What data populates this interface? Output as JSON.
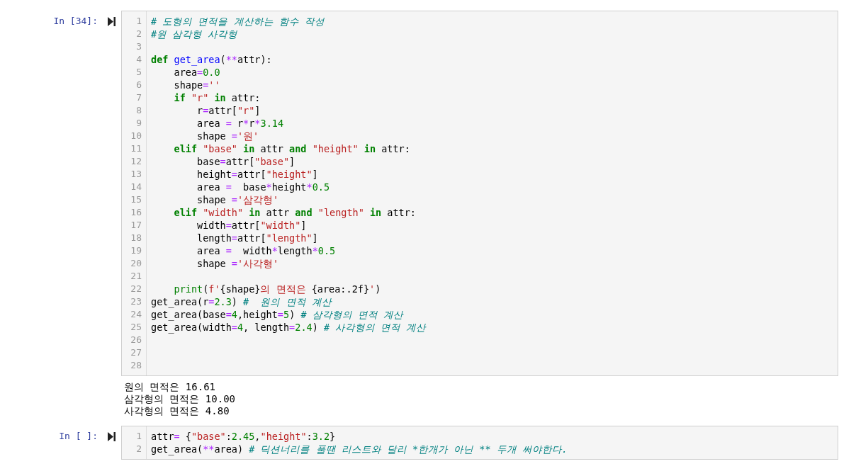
{
  "cells": [
    {
      "prompt": "In [34]:",
      "lines": [
        {
          "number": "1",
          "tokens": [
            {
              "text": "# 도형의 면적을 계산하는 함수 작성",
              "kind": "comment"
            }
          ]
        },
        {
          "number": "2",
          "tokens": [
            {
              "text": "#원 삼각형 사각형",
              "kind": "comment"
            }
          ]
        },
        {
          "number": "3"
        },
        {
          "number": "4",
          "tokens": [
            {
              "text": "def",
              "kind": "keyword"
            },
            {
              "text": " get_area",
              "kind": "function"
            },
            {
              "text": "(",
              "kind": "plain"
            },
            {
              "text": "**",
              "kind": "operator"
            },
            {
              "text": "attr):",
              "kind": "plain"
            }
          ]
        },
        {
          "number": "5",
          "tokens": [
            {
              "text": "    area",
              "kind": "plain"
            },
            {
              "text": "=",
              "kind": "operator"
            },
            {
              "text": "0.0",
              "kind": "number"
            }
          ]
        },
        {
          "number": "6",
          "tokens": [
            {
              "text": "    shape",
              "kind": "plain"
            },
            {
              "text": "=",
              "kind": "operator"
            },
            {
              "text": "''",
              "kind": "string"
            }
          ]
        },
        {
          "number": "7",
          "tokens": [
            {
              "text": "    if",
              "kind": "keyword"
            },
            {
              "text": " \"r\"",
              "kind": "string"
            },
            {
              "text": " in",
              "kind": "keyword"
            },
            {
              "text": " attr:",
              "kind": "plain"
            }
          ]
        },
        {
          "number": "8",
          "tokens": [
            {
              "text": "        r",
              "kind": "plain"
            },
            {
              "text": "=",
              "kind": "operator"
            },
            {
              "text": "attr[",
              "kind": "plain"
            },
            {
              "text": "\"r\"",
              "kind": "string"
            },
            {
              "text": "]",
              "kind": "plain"
            }
          ]
        },
        {
          "number": "9",
          "tokens": [
            {
              "text": "        area ",
              "kind": "plain"
            },
            {
              "text": "=",
              "kind": "operator"
            },
            {
              "text": " r",
              "kind": "plain"
            },
            {
              "text": "*",
              "kind": "operator"
            },
            {
              "text": "r",
              "kind": "plain"
            },
            {
              "text": "*",
              "kind": "operator"
            },
            {
              "text": "3.14",
              "kind": "number"
            }
          ]
        },
        {
          "number": "10",
          "tokens": [
            {
              "text": "        shape ",
              "kind": "plain"
            },
            {
              "text": "=",
              "kind": "operator"
            },
            {
              "text": "'원'",
              "kind": "string"
            }
          ]
        },
        {
          "number": "11",
          "tokens": [
            {
              "text": "    elif",
              "kind": "keyword"
            },
            {
              "text": " \"base\"",
              "kind": "string"
            },
            {
              "text": " in",
              "kind": "keyword"
            },
            {
              "text": " attr ",
              "kind": "plain"
            },
            {
              "text": "and",
              "kind": "keyword"
            },
            {
              "text": " \"height\"",
              "kind": "string"
            },
            {
              "text": " in",
              "kind": "keyword"
            },
            {
              "text": " attr:",
              "kind": "plain"
            }
          ]
        },
        {
          "number": "12",
          "tokens": [
            {
              "text": "        base",
              "kind": "plain"
            },
            {
              "text": "=",
              "kind": "operator"
            },
            {
              "text": "attr[",
              "kind": "plain"
            },
            {
              "text": "\"base\"",
              "kind": "string"
            },
            {
              "text": "]",
              "kind": "plain"
            }
          ]
        },
        {
          "number": "13",
          "tokens": [
            {
              "text": "        height",
              "kind": "plain"
            },
            {
              "text": "=",
              "kind": "operator"
            },
            {
              "text": "attr[",
              "kind": "plain"
            },
            {
              "text": "\"height\"",
              "kind": "string"
            },
            {
              "text": "]",
              "kind": "plain"
            }
          ]
        },
        {
          "number": "14",
          "tokens": [
            {
              "text": "        area ",
              "kind": "plain"
            },
            {
              "text": "=",
              "kind": "operator"
            },
            {
              "text": "  base",
              "kind": "plain"
            },
            {
              "text": "*",
              "kind": "operator"
            },
            {
              "text": "height",
              "kind": "plain"
            },
            {
              "text": "*",
              "kind": "operator"
            },
            {
              "text": "0.5",
              "kind": "number"
            }
          ]
        },
        {
          "number": "15",
          "tokens": [
            {
              "text": "        shape ",
              "kind": "plain"
            },
            {
              "text": "=",
              "kind": "operator"
            },
            {
              "text": "'삼각형'",
              "kind": "string"
            }
          ]
        },
        {
          "number": "16",
          "tokens": [
            {
              "text": "    elif",
              "kind": "keyword"
            },
            {
              "text": " \"width\"",
              "kind": "string"
            },
            {
              "text": " in",
              "kind": "keyword"
            },
            {
              "text": " attr ",
              "kind": "plain"
            },
            {
              "text": "and",
              "kind": "keyword"
            },
            {
              "text": " \"length\"",
              "kind": "string"
            },
            {
              "text": " in",
              "kind": "keyword"
            },
            {
              "text": " attr:",
              "kind": "plain"
            }
          ]
        },
        {
          "number": "17",
          "tokens": [
            {
              "text": "        width",
              "kind": "plain"
            },
            {
              "text": "=",
              "kind": "operator"
            },
            {
              "text": "attr[",
              "kind": "plain"
            },
            {
              "text": "\"width\"",
              "kind": "string"
            },
            {
              "text": "]",
              "kind": "plain"
            }
          ]
        },
        {
          "number": "18",
          "tokens": [
            {
              "text": "        length",
              "kind": "plain"
            },
            {
              "text": "=",
              "kind": "operator"
            },
            {
              "text": "attr[",
              "kind": "plain"
            },
            {
              "text": "\"length\"",
              "kind": "string"
            },
            {
              "text": "]",
              "kind": "plain"
            }
          ]
        },
        {
          "number": "19",
          "tokens": [
            {
              "text": "        area ",
              "kind": "plain"
            },
            {
              "text": "=",
              "kind": "operator"
            },
            {
              "text": "  width",
              "kind": "plain"
            },
            {
              "text": "*",
              "kind": "operator"
            },
            {
              "text": "length",
              "kind": "plain"
            },
            {
              "text": "*",
              "kind": "operator"
            },
            {
              "text": "0.5",
              "kind": "number"
            }
          ]
        },
        {
          "number": "20",
          "tokens": [
            {
              "text": "        shape ",
              "kind": "plain"
            },
            {
              "text": "=",
              "kind": "operator"
            },
            {
              "text": "'사각형'",
              "kind": "string"
            }
          ]
        },
        {
          "number": "21"
        },
        {
          "number": "22",
          "tokens": [
            {
              "text": "    print",
              "kind": "builtin"
            },
            {
              "text": "(",
              "kind": "plain"
            },
            {
              "text": "f'",
              "kind": "string"
            },
            {
              "text": "{shape}",
              "kind": "plain"
            },
            {
              "text": "의 면적은 ",
              "kind": "string"
            },
            {
              "text": "{area:.2f}",
              "kind": "plain"
            },
            {
              "text": "'",
              "kind": "string"
            },
            {
              "text": ")",
              "kind": "plain"
            }
          ]
        },
        {
          "number": "23",
          "tokens": [
            {
              "text": "get_area(r",
              "kind": "plain"
            },
            {
              "text": "=",
              "kind": "operator"
            },
            {
              "text": "2.3",
              "kind": "number"
            },
            {
              "text": ") ",
              "kind": "plain"
            },
            {
              "text": "#  원의 면적 계산",
              "kind": "comment"
            }
          ]
        },
        {
          "number": "24",
          "tokens": [
            {
              "text": "get_area(base",
              "kind": "plain"
            },
            {
              "text": "=",
              "kind": "operator"
            },
            {
              "text": "4",
              "kind": "number"
            },
            {
              "text": ",height",
              "kind": "plain"
            },
            {
              "text": "=",
              "kind": "operator"
            },
            {
              "text": "5",
              "kind": "number"
            },
            {
              "text": ") ",
              "kind": "plain"
            },
            {
              "text": "# 삼각형의 면적 계산",
              "kind": "comment"
            }
          ]
        },
        {
          "number": "25",
          "tokens": [
            {
              "text": "get_area(width",
              "kind": "plain"
            },
            {
              "text": "=",
              "kind": "operator"
            },
            {
              "text": "4",
              "kind": "number"
            },
            {
              "text": ", length",
              "kind": "plain"
            },
            {
              "text": "=",
              "kind": "operator"
            },
            {
              "text": "2.4",
              "kind": "number"
            },
            {
              "text": ") ",
              "kind": "plain"
            },
            {
              "text": "# 사각형의 면적 계산",
              "kind": "comment"
            }
          ]
        },
        {
          "number": "26"
        },
        {
          "number": "27"
        },
        {
          "number": "28"
        }
      ],
      "output": [
        "원의 면적은 16.61",
        "삼각형의 면적은 10.00",
        "사각형의 면적은 4.80"
      ]
    },
    {
      "prompt": "In [ ]:",
      "lines": [
        {
          "number": "1",
          "tokens": [
            {
              "text": "attr",
              "kind": "plain"
            },
            {
              "text": "=",
              "kind": "operator"
            },
            {
              "text": " {",
              "kind": "plain"
            },
            {
              "text": "\"base\"",
              "kind": "string"
            },
            {
              "text": ":",
              "kind": "plain"
            },
            {
              "text": "2.45",
              "kind": "number"
            },
            {
              "text": ",",
              "kind": "plain"
            },
            {
              "text": "\"height\"",
              "kind": "string"
            },
            {
              "text": ":",
              "kind": "plain"
            },
            {
              "text": "3.2",
              "kind": "number"
            },
            {
              "text": "}",
              "kind": "plain"
            }
          ]
        },
        {
          "number": "2",
          "tokens": [
            {
              "text": "get_area(",
              "kind": "plain"
            },
            {
              "text": "**",
              "kind": "operator"
            },
            {
              "text": "area) ",
              "kind": "plain"
            },
            {
              "text": "# 딕션너리를 풀땐 리스트와 달리 *한개가 아닌 ** 두개 써야한다.",
              "kind": "comment"
            }
          ]
        }
      ]
    }
  ]
}
